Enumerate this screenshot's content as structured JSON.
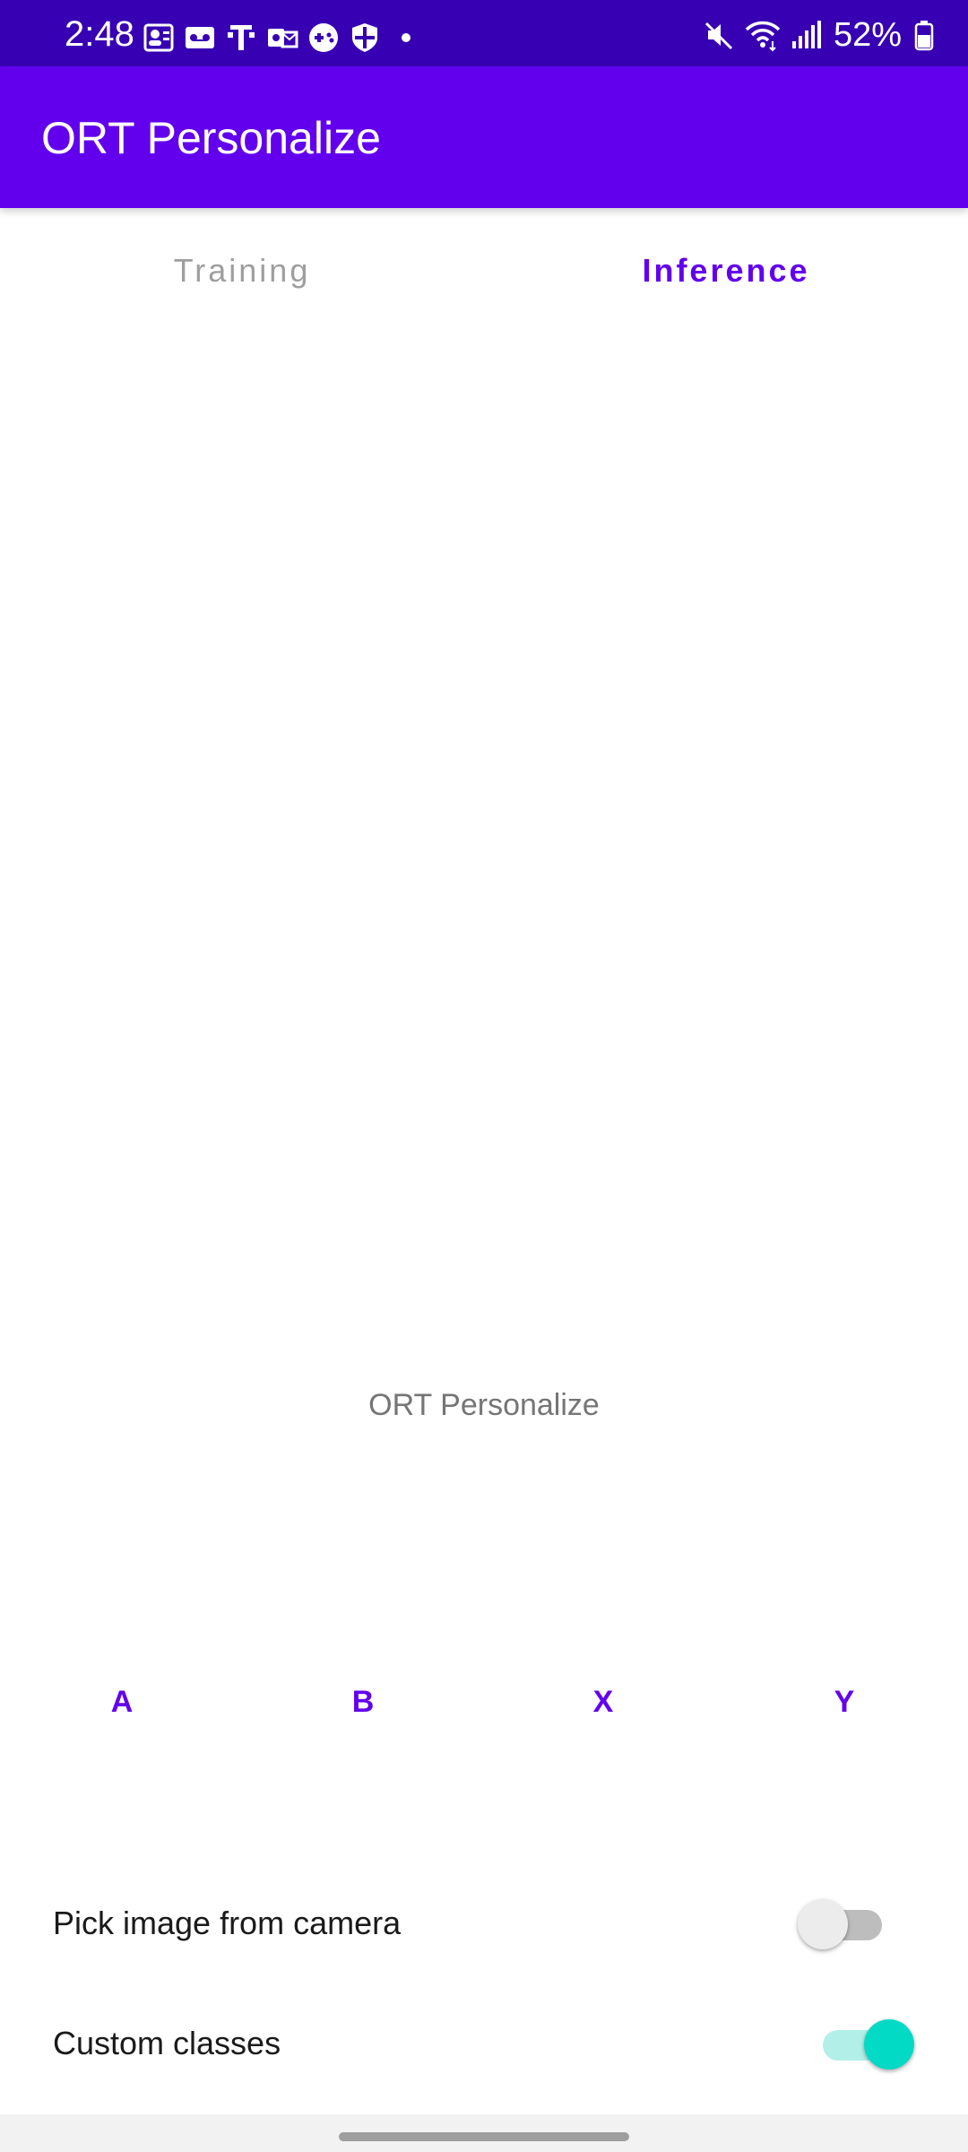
{
  "status_bar": {
    "time": "2:48",
    "battery": "52%",
    "background": "#3700b3",
    "icons_left": [
      "contacts-icon",
      "voicemail-icon",
      "t-mobile-icon",
      "outlook-icon",
      "game-icon",
      "shield-icon",
      "dot-icon"
    ],
    "icons_right": [
      "mute-icon",
      "wifi-icon",
      "signal-icon",
      "battery-icon"
    ]
  },
  "app_bar": {
    "title": "ORT Personalize",
    "color": "#6200ee"
  },
  "tabs": [
    {
      "label": "Training",
      "active": false
    },
    {
      "label": "Inference",
      "active": true
    }
  ],
  "content": {
    "caption": "ORT Personalize"
  },
  "class_buttons": [
    {
      "label": "A"
    },
    {
      "label": "B"
    },
    {
      "label": "X"
    },
    {
      "label": "Y"
    }
  ],
  "settings": [
    {
      "label": "Pick image from camera",
      "checked": false
    },
    {
      "label": "Custom classes",
      "checked": true
    }
  ],
  "colors": {
    "accent": "#03dac5",
    "primary": "#6200ee"
  }
}
